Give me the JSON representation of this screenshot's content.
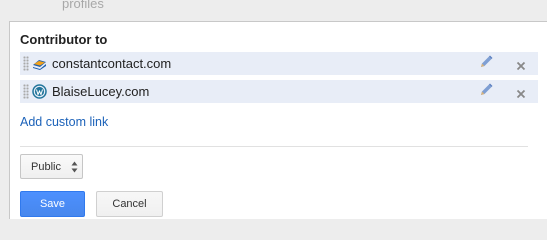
{
  "background_text": "profiles",
  "section": {
    "title": "Contributor to"
  },
  "links": [
    {
      "label": "constantcontact.com",
      "icon": "constantcontact-favicon-icon"
    },
    {
      "label": "BlaiseLucey.com",
      "icon": "wordpress-favicon-icon"
    }
  ],
  "add_link_label": "Add custom link",
  "privacy": {
    "selected": "Public"
  },
  "buttons": {
    "save": "Save",
    "cancel": "Cancel"
  },
  "colors": {
    "row_bg": "#e8edf7",
    "link": "#1c62b9",
    "primary_button": "#4d90fe"
  }
}
